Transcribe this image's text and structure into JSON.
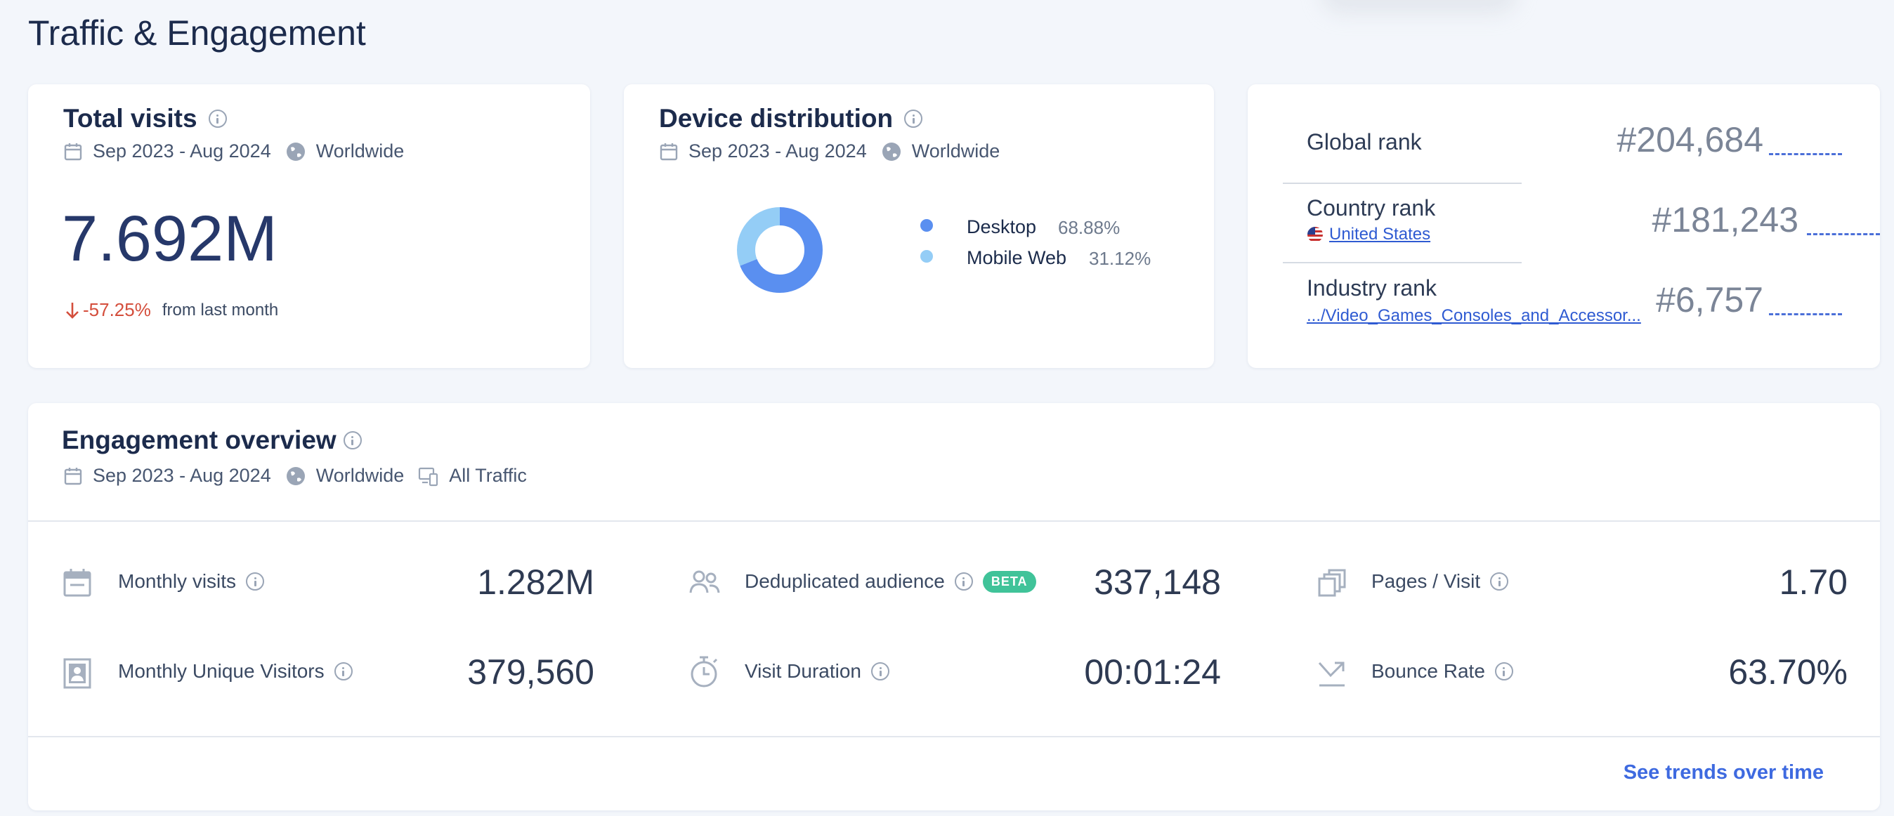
{
  "page": {
    "title": "Traffic & Engagement"
  },
  "total_visits": {
    "title": "Total visits",
    "period": "Sep 2023 - Aug 2024",
    "region": "Worldwide",
    "value": "7.692M",
    "change": "-57.25%",
    "change_note": "from last month"
  },
  "device_distribution": {
    "title": "Device distribution",
    "period": "Sep 2023 - Aug 2024",
    "region": "Worldwide",
    "items": [
      {
        "label": "Desktop",
        "value": "68.88%",
        "fraction": 0.6888,
        "color": "#5a8ff0"
      },
      {
        "label": "Mobile Web",
        "value": "31.12%",
        "fraction": 0.3112,
        "color": "#94cdf6"
      }
    ]
  },
  "ranks": {
    "global": {
      "label": "Global rank",
      "value": "#204,684"
    },
    "country": {
      "label": "Country rank",
      "country": "United States",
      "value": "#181,243"
    },
    "industry": {
      "label": "Industry rank",
      "category": ".../Video_Games_Consoles_and_Accessor...",
      "value": "#6,757"
    }
  },
  "engagement": {
    "title": "Engagement overview",
    "period": "Sep 2023 - Aug 2024",
    "region": "Worldwide",
    "traffic": "All Traffic",
    "metrics": {
      "monthly_visits": {
        "label": "Monthly visits",
        "value": "1.282M"
      },
      "dedup_audience": {
        "label": "Deduplicated audience",
        "badge": "BETA",
        "value": "337,148"
      },
      "pages_visit": {
        "label": "Pages / Visit",
        "value": "1.70"
      },
      "unique_visitors": {
        "label": "Monthly Unique Visitors",
        "value": "379,560"
      },
      "visit_duration": {
        "label": "Visit Duration",
        "value": "00:01:24"
      },
      "bounce_rate": {
        "label": "Bounce Rate",
        "value": "63.70%"
      }
    },
    "see_trends": "See trends over time"
  },
  "colors": {
    "accent": "#3e6ae0",
    "negative": "#d44e3c",
    "beta": "#40c399"
  }
}
